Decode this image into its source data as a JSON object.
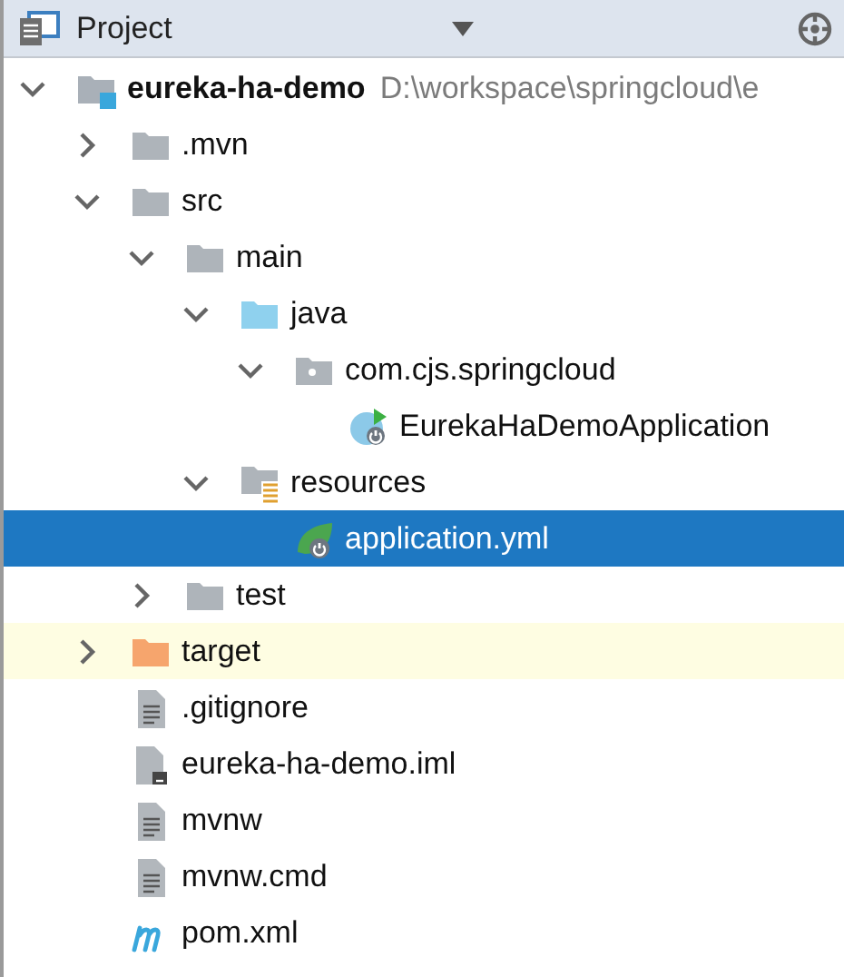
{
  "panel": {
    "title": "Project"
  },
  "tree": [
    {
      "name": "eureka-ha-demo",
      "path": "D:\\workspace\\springcloud\\e",
      "kind": "module",
      "expanded": true,
      "selected": false,
      "children": [
        {
          "name": ".mvn",
          "kind": "folder",
          "expanded": false,
          "selected": false
        },
        {
          "name": "src",
          "kind": "folder",
          "expanded": true,
          "selected": false,
          "children": [
            {
              "name": "main",
              "kind": "folder",
              "expanded": true,
              "selected": false,
              "children": [
                {
                  "name": "java",
                  "kind": "source",
                  "expanded": true,
                  "selected": false,
                  "children": [
                    {
                      "name": "com.cjs.springcloud",
                      "kind": "package",
                      "expanded": true,
                      "selected": false,
                      "children": [
                        {
                          "name": "EurekaHaDemoApplication",
                          "kind": "spring-class",
                          "selected": false
                        }
                      ]
                    }
                  ]
                },
                {
                  "name": "resources",
                  "kind": "resources",
                  "expanded": true,
                  "selected": false,
                  "children": [
                    {
                      "name": "application.yml",
                      "kind": "spring-config",
                      "selected": true
                    }
                  ]
                }
              ]
            },
            {
              "name": "test",
              "kind": "folder",
              "expanded": false,
              "selected": false
            }
          ]
        },
        {
          "name": "target",
          "kind": "ignored-folder",
          "expanded": false,
          "selected": false
        },
        {
          "name": ".gitignore",
          "kind": "text",
          "selected": false
        },
        {
          "name": "eureka-ha-demo.iml",
          "kind": "module-file",
          "selected": false
        },
        {
          "name": "mvnw",
          "kind": "text",
          "selected": false
        },
        {
          "name": "mvnw.cmd",
          "kind": "text",
          "selected": false
        },
        {
          "name": "pom.xml",
          "kind": "maven",
          "selected": false
        }
      ]
    }
  ]
}
